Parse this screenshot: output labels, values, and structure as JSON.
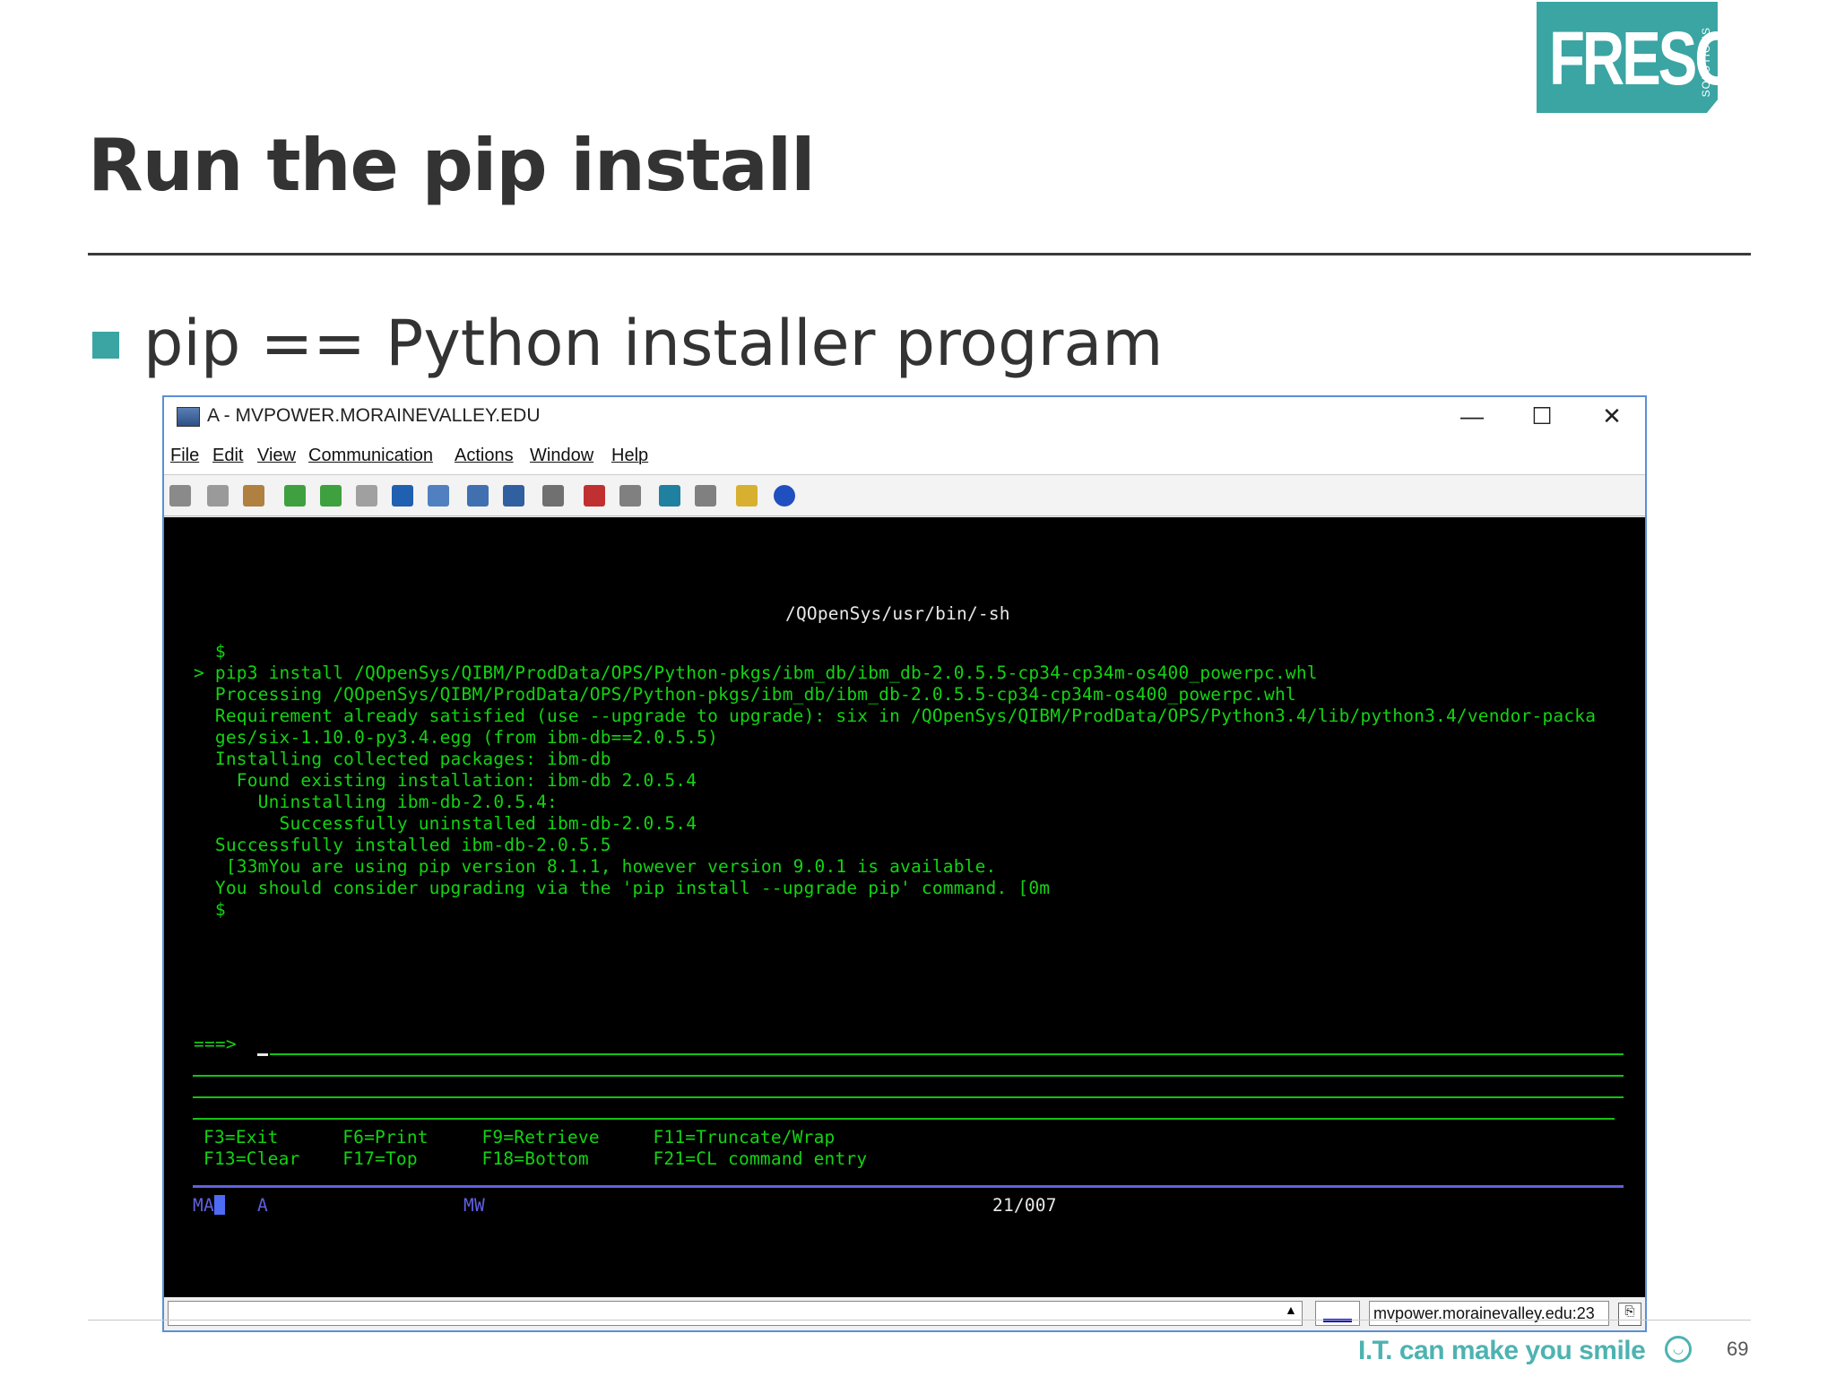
{
  "slide": {
    "title": "Run the pip install",
    "bullet": "pip == Python installer program",
    "logo": {
      "word": "FRESCHE",
      "sub": "SOLUTIONS",
      "color": "#3aa5a3"
    },
    "tagline": "I.T. can make you smile",
    "page_number": "69"
  },
  "window": {
    "title": "A - MVPOWER.MORAINEVALLEY.EDU",
    "controls": {
      "minimize": "—",
      "maximize": "☐",
      "close": "✕"
    },
    "menu": [
      "File",
      "Edit",
      "View",
      "Communication",
      "Actions",
      "Window",
      "Help"
    ],
    "toolbar_icons": [
      "copy-screen-icon",
      "copy-icon",
      "paste-icon",
      "send-file-icon",
      "receive-file-icon",
      "print-icon",
      "macro-icon",
      "keypad-icon",
      "display-icon",
      "grid-icon",
      "tools-icon",
      "record-icon",
      "stop-icon",
      "play-icon",
      "pause-icon",
      "notes-icon",
      "help-icon"
    ]
  },
  "terminal": {
    "colors": {
      "text": "#13d313",
      "background": "#000000",
      "divider": "#6060e0"
    },
    "header": "/QOpenSys/usr/bin/-sh",
    "output": [
      "  $",
      "> pip3 install /QOpenSys/QIBM/ProdData/OPS/Python-pkgs/ibm_db/ibm_db-2.0.5.5-cp34-cp34m-os400_powerpc.whl",
      "  Processing /QOpenSys/QIBM/ProdData/OPS/Python-pkgs/ibm_db/ibm_db-2.0.5.5-cp34-cp34m-os400_powerpc.whl",
      "  Requirement already satisfied (use --upgrade to upgrade): six in /QOpenSys/QIBM/ProdData/OPS/Python3.4/lib/python3.4/vendor-packa",
      "  ges/six-1.10.0-py3.4.egg (from ibm-db==2.0.5.5)",
      "  Installing collected packages: ibm-db",
      "    Found existing installation: ibm-db 2.0.5.4",
      "      Uninstalling ibm-db-2.0.5.4:",
      "        Successfully uninstalled ibm-db-2.0.5.4",
      "  Successfully installed ibm-db-2.0.5.5",
      "   [33mYou are using pip version 8.1.1, however version 9.0.1 is available.",
      "  You should consider upgrading via the 'pip install --upgrade pip' command. [0m",
      "  $"
    ],
    "prompt": "===>",
    "fkeys_row1": "F3=Exit      F6=Print     F9=Retrieve     F11=Truncate/Wrap",
    "fkeys_row2": "F13=Clear    F17=Top      F18=Bottom      F21=CL command entry",
    "status_ma": "MA",
    "status_a": "A",
    "status_mw": "MW",
    "status_pos": "21/007"
  },
  "statusbar": {
    "host": "mvpower.morainevalley.edu:23"
  }
}
